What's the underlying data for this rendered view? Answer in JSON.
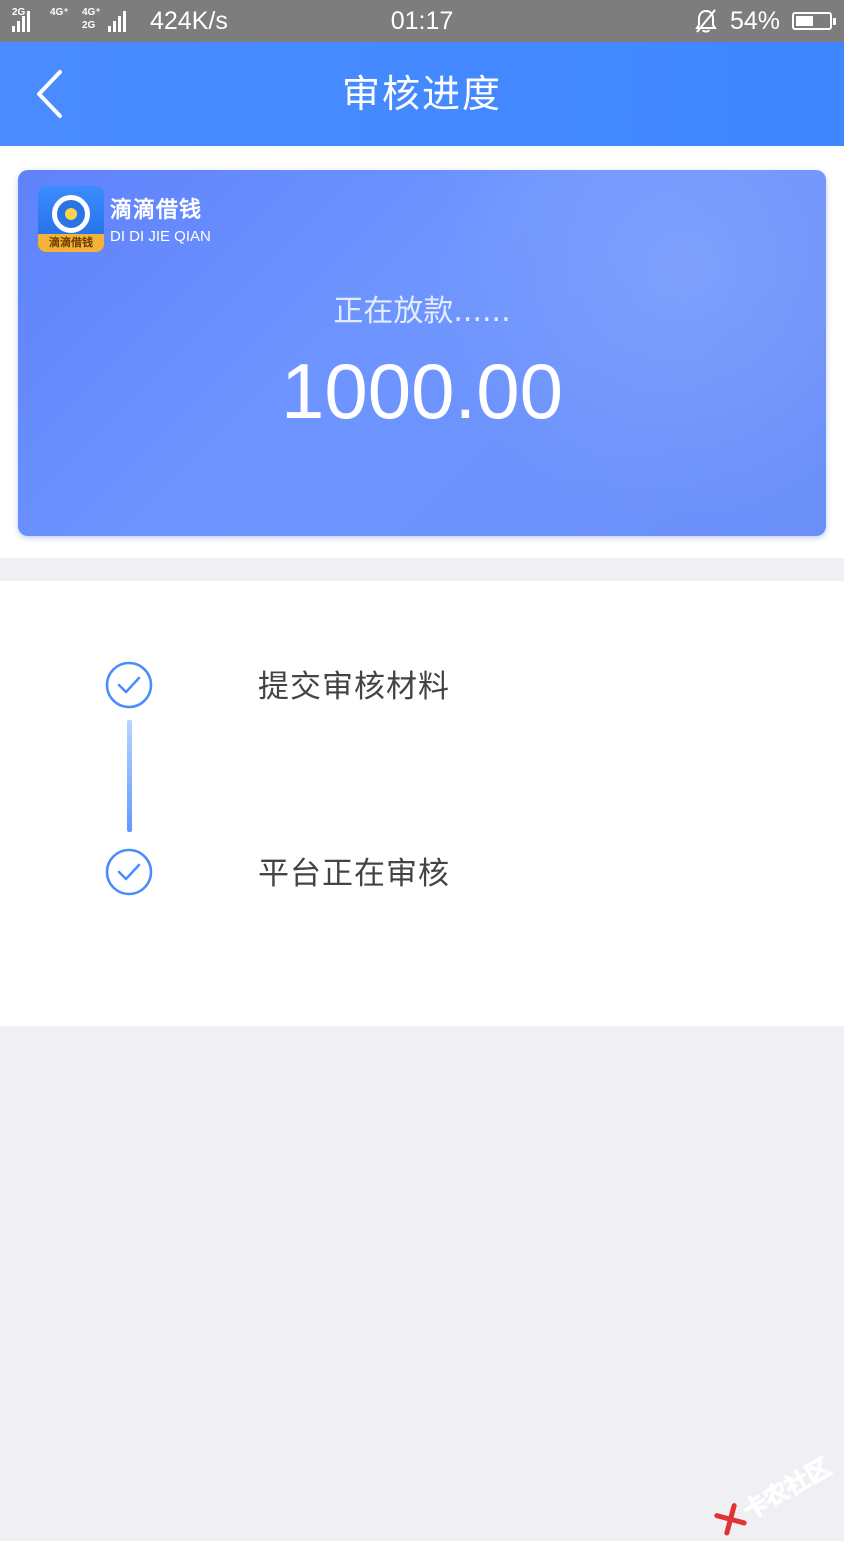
{
  "status_bar": {
    "network_1": "2G",
    "network_2": "4G⁺",
    "network_3": "4G⁺",
    "network_4": "2G",
    "speed": "424K/s",
    "time": "01:17",
    "battery_percent": "54%",
    "battery_level": 0.54,
    "mute_icon": "bell-muted-icon"
  },
  "nav": {
    "title": "审核进度",
    "back_icon": "chevron-left-icon"
  },
  "card": {
    "brand_name": "滴滴借钱",
    "brand_pinyin": "DI DI JIE QIAN",
    "logo_band_text": "滴滴借钱",
    "status_text": "正在放款......",
    "amount": "1000.00",
    "accent_color": "#6a8ff8"
  },
  "progress": {
    "steps": [
      {
        "label": "提交审核材料",
        "icon": "check-circle-icon"
      },
      {
        "label": "平台正在审核",
        "icon": "check-circle-icon"
      }
    ],
    "accent_color": "#4a8cff"
  },
  "watermark": {
    "text": "卡农社区"
  }
}
